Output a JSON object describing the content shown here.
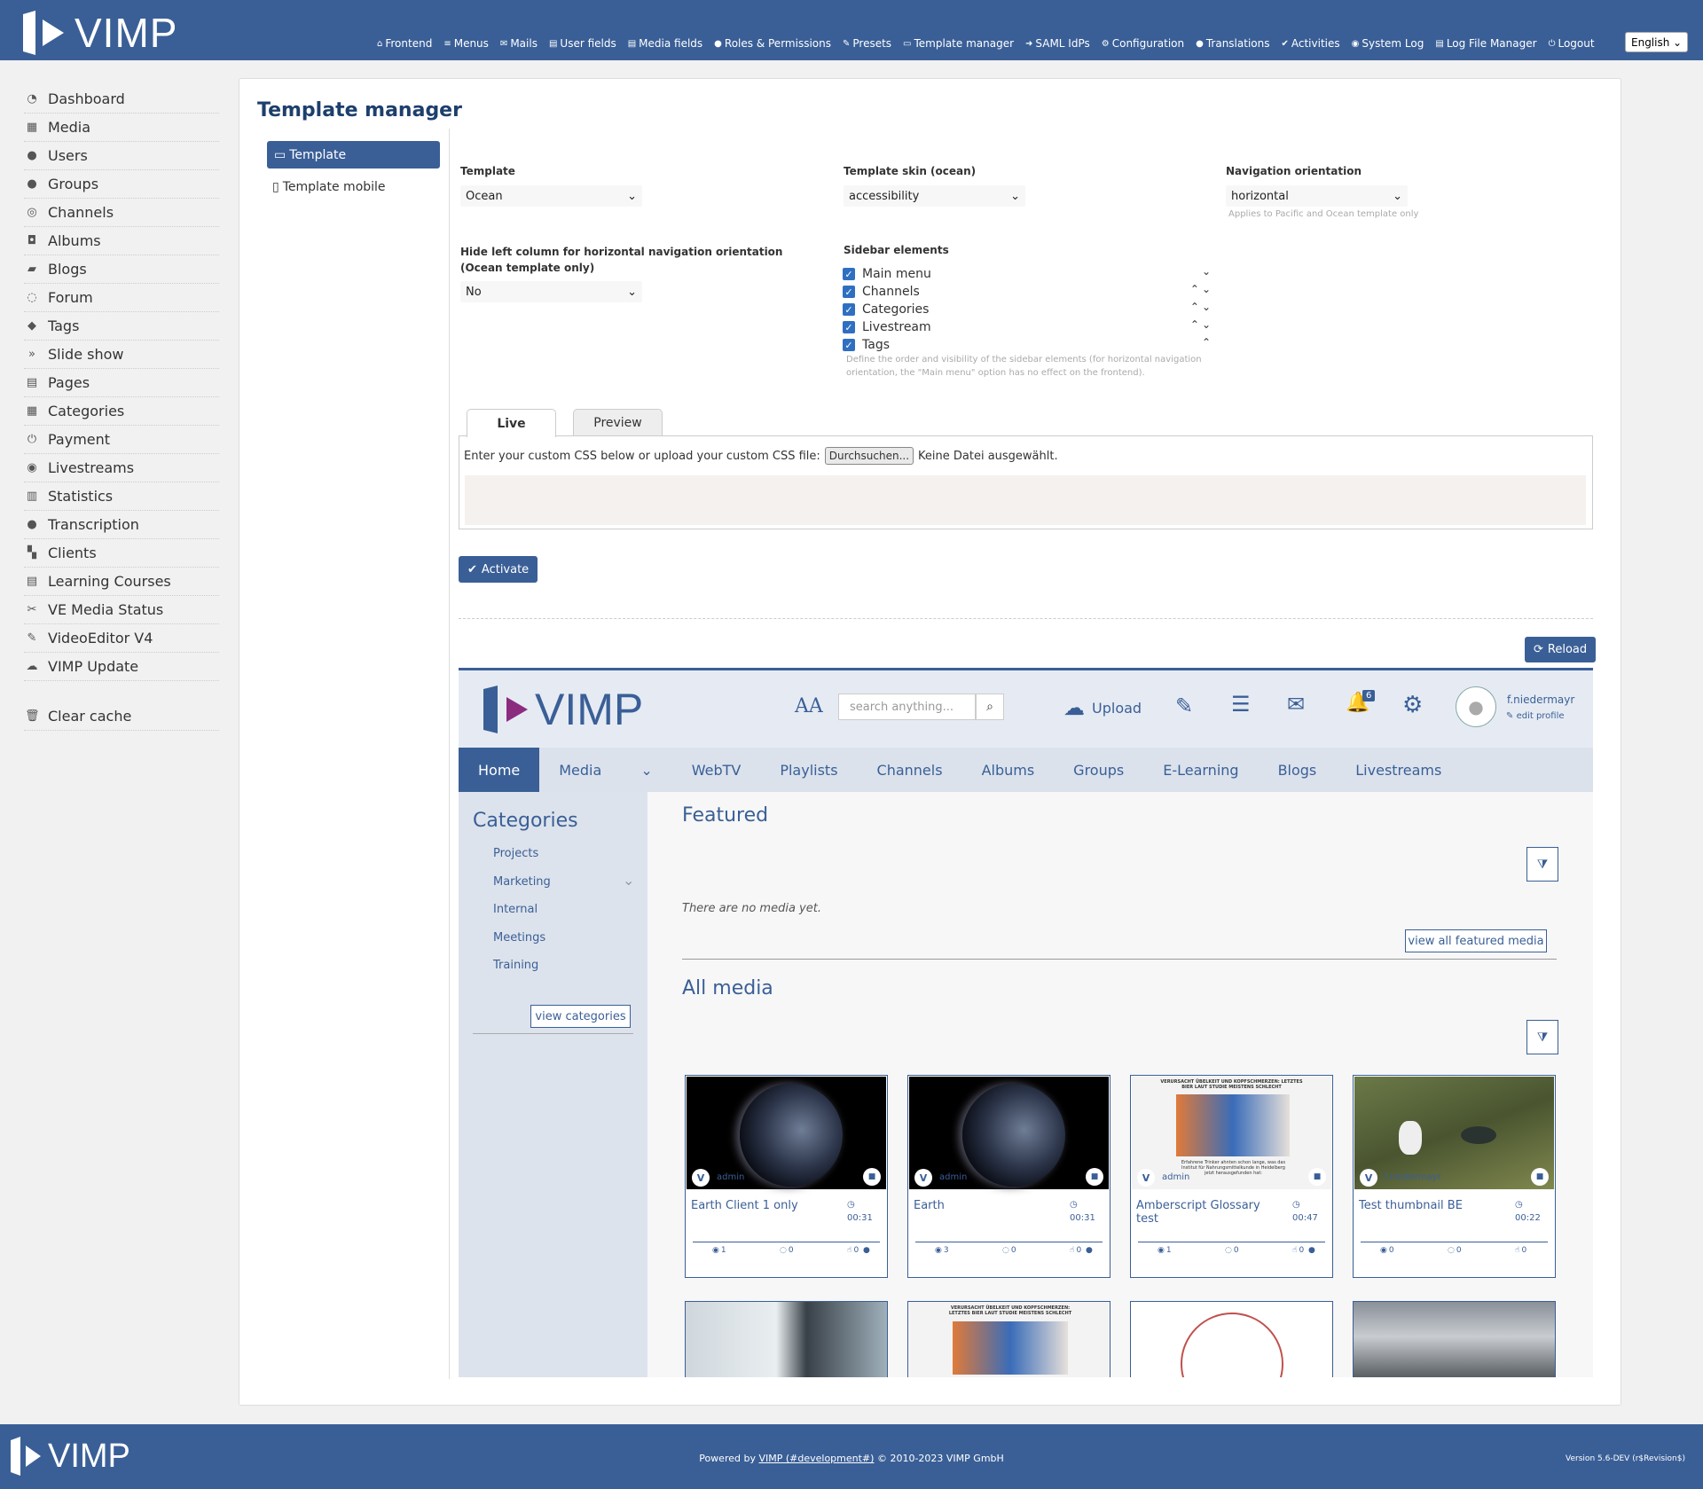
{
  "brand": "VIMP",
  "topnav": [
    {
      "icon": "home-icon",
      "glyph": "⌂",
      "label": "Frontend"
    },
    {
      "icon": "menu-icon",
      "glyph": "≡",
      "label": "Menus"
    },
    {
      "icon": "mail-icon",
      "glyph": "✉",
      "label": "Mails"
    },
    {
      "icon": "file-icon",
      "glyph": "▤",
      "label": "User fields"
    },
    {
      "icon": "file-icon",
      "glyph": "▤",
      "label": "Media fields"
    },
    {
      "icon": "user-icon",
      "glyph": "●",
      "label": "Roles & Permissions"
    },
    {
      "icon": "wrench-icon",
      "glyph": "✎",
      "label": "Presets"
    },
    {
      "icon": "monitor-icon",
      "glyph": "▭",
      "label": "Template manager"
    },
    {
      "icon": "login-icon",
      "glyph": "➜",
      "label": "SAML IdPs"
    },
    {
      "icon": "cogs-icon",
      "glyph": "⚙",
      "label": "Configuration"
    },
    {
      "icon": "comment-icon",
      "glyph": "●",
      "label": "Translations"
    },
    {
      "icon": "check-icon",
      "glyph": "✔",
      "label": "Activities"
    },
    {
      "icon": "eye-icon",
      "glyph": "◉",
      "label": "System Log"
    },
    {
      "icon": "file-icon",
      "glyph": "▤",
      "label": "Log File Manager"
    },
    {
      "icon": "power-icon",
      "glyph": "⏻",
      "label": "Logout"
    }
  ],
  "language": "English",
  "sidebar": [
    {
      "icon": "dashboard-icon",
      "glyph": "◔",
      "label": "Dashboard"
    },
    {
      "icon": "film-icon",
      "glyph": "▦",
      "label": "Media"
    },
    {
      "icon": "users-icon",
      "glyph": "●",
      "label": "Users"
    },
    {
      "icon": "groups-icon",
      "glyph": "●",
      "label": "Groups"
    },
    {
      "icon": "channels-icon",
      "glyph": "◎",
      "label": "Channels"
    },
    {
      "icon": "camera-icon",
      "glyph": "◘",
      "label": "Albums"
    },
    {
      "icon": "book-icon",
      "glyph": "▰",
      "label": "Blogs"
    },
    {
      "icon": "forum-icon",
      "glyph": "◌",
      "label": "Forum"
    },
    {
      "icon": "tags-icon",
      "glyph": "◆",
      "label": "Tags"
    },
    {
      "icon": "slideshow-icon",
      "glyph": "»",
      "label": "Slide show"
    },
    {
      "icon": "page-icon",
      "glyph": "▤",
      "label": "Pages"
    },
    {
      "icon": "grid-icon",
      "glyph": "▦",
      "label": "Categories"
    },
    {
      "icon": "power-icon",
      "glyph": "⏻",
      "label": "Payment"
    },
    {
      "icon": "play-circle-icon",
      "glyph": "◉",
      "label": "Livestreams"
    },
    {
      "icon": "bar-chart-icon",
      "glyph": "▥",
      "label": "Statistics"
    },
    {
      "icon": "comment-icon",
      "glyph": "●",
      "label": "Transcription"
    },
    {
      "icon": "sitemap-icon",
      "glyph": "▚",
      "label": "Clients"
    },
    {
      "icon": "file-icon",
      "glyph": "▤",
      "label": "Learning Courses"
    },
    {
      "icon": "scissors-icon",
      "glyph": "✂",
      "label": "VE Media Status"
    },
    {
      "icon": "edit-icon",
      "glyph": "✎",
      "label": "VideoEditor V4"
    },
    {
      "icon": "cloud-upload-icon",
      "glyph": "☁",
      "label": "VIMP Update"
    }
  ],
  "clear_cache": "Clear cache",
  "page_title": "Template manager",
  "sub_tabs": {
    "template": "Template",
    "mobile": "Template mobile"
  },
  "fields": {
    "template_label": "Template",
    "template_value": "Ocean",
    "skin_label": "Template skin (ocean)",
    "skin_value": "accessibility",
    "nav_label": "Navigation orientation",
    "nav_value": "horizontal",
    "nav_hint": "Applies to Pacific and Ocean template only",
    "hide_label": "Hide left column for horizontal navigation orientation (Ocean template only)",
    "hide_value": "No",
    "sidebar_label": "Sidebar elements",
    "sidebar_elements": [
      "Main menu",
      "Channels",
      "Categories",
      "Livestream",
      "Tags"
    ],
    "sidebar_hint": "Define the order and visibility of the sidebar elements (for horizontal navigation orientation, the \"Main menu\" option has no effect on the frontend)."
  },
  "css_tabs": {
    "live": "Live",
    "preview": "Preview"
  },
  "css_upload_text": "Enter your custom CSS below or upload your custom CSS file:",
  "browse_button": "Durchsuchen...",
  "no_file": "Keine Datei ausgewählt.",
  "activate": "Activate",
  "reload": "Reload",
  "preview": {
    "search_placeholder": "search anything...",
    "upload": "Upload",
    "notif_count": "6",
    "username": "f.niedermayr",
    "edit_profile": "edit profile",
    "nav": [
      "Home",
      "Media",
      "WebTV",
      "Playlists",
      "Channels",
      "Albums",
      "Groups",
      "E-Learning",
      "Blogs",
      "Livestreams"
    ],
    "categories_title": "Categories",
    "categories": [
      "Projects",
      "Marketing",
      "Internal",
      "Meetings",
      "Training"
    ],
    "view_categories": "view categories",
    "featured_title": "Featured",
    "no_media": "There are no media yet.",
    "view_featured": "view all featured media",
    "all_media_title": "All media",
    "cards": [
      {
        "title": "Earth Client 1 only",
        "duration": "00:31",
        "owner": "admin",
        "views": "1",
        "comments": "0",
        "likes": "0",
        "thumb": "earth"
      },
      {
        "title": "Earth",
        "duration": "00:31",
        "owner": "admin",
        "views": "3",
        "comments": "0",
        "likes": "0",
        "thumb": "earth"
      },
      {
        "title": "Amberscript Glossary test",
        "duration": "00:47",
        "owner": "admin",
        "views": "1",
        "comments": "0",
        "likes": "0",
        "thumb": "news"
      },
      {
        "title": "Test thumbnail BE",
        "duration": "00:22",
        "owner": "f.niedermayr",
        "views": "0",
        "comments": "0",
        "likes": "0",
        "thumb": "duck"
      }
    ],
    "news_headline": "VERURSACHT ÜBELKEIT UND KOPFSCHMERZEN: LETZTES BIER LAUT STUDIE MEISTENS SCHLECHT",
    "news_caption": "Erfahrene Trinker ahnten schon lange, was das Institut für Nahrungsmittelkunde in Heidelberg jetzt herausgefunden hat:"
  },
  "footer": {
    "powered": "Powered by",
    "link": "VIMP (#development#)",
    "copyright": "© 2010-2023 VIMP GmbH",
    "version": "Version 5.6-DEV (r$Revision$)"
  },
  "colors": {
    "brand": "#3a5f97",
    "accent": "#1d3f6c",
    "checkbox": "#2f6fc1"
  }
}
